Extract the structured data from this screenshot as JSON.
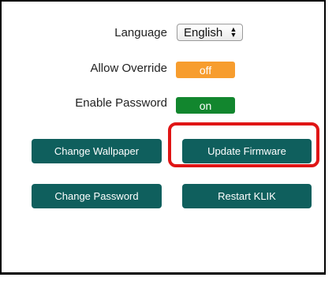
{
  "settings": {
    "language_label": "Language",
    "language_value": "English",
    "language_arrows": "▲▼",
    "allow_override_label": "Allow Override",
    "allow_override_value": "off",
    "enable_password_label": "Enable Password",
    "enable_password_value": "on"
  },
  "buttons": {
    "change_wallpaper": "Change Wallpaper",
    "update_firmware": "Update Firmware",
    "change_password": "Change Password",
    "restart": "Restart KLIK"
  },
  "colors": {
    "button_bg": "#0f5f5d",
    "toggle_off": "#f79d2e",
    "toggle_on": "#12862e",
    "highlight": "#e01515"
  }
}
